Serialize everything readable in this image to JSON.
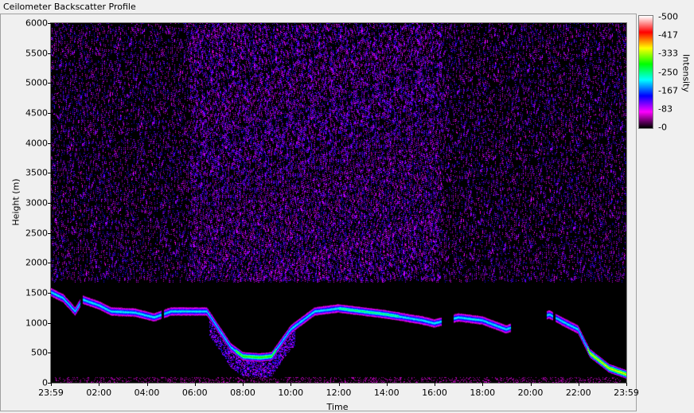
{
  "window": {
    "title": "Ceilometer Backscatter Profile"
  },
  "chart_data": {
    "type": "heatmap",
    "title": "",
    "xlabel": "Time",
    "ylabel": "Height (m)",
    "x_ticks": [
      "23:59",
      "02:00",
      "04:00",
      "06:00",
      "08:00",
      "10:00",
      "12:00",
      "14:00",
      "16:00",
      "18:00",
      "20:00",
      "22:00",
      "23:59"
    ],
    "x_range": [
      "23:59",
      "23:59"
    ],
    "y_ticks": [
      0,
      500,
      1000,
      1500,
      2000,
      2500,
      3000,
      3500,
      4000,
      4500,
      5000,
      5500,
      6000
    ],
    "ylim": [
      0,
      6000
    ],
    "colorbar": {
      "label": "Intensity",
      "ticks": [
        "-500",
        "-417",
        "-333",
        "-250",
        "-167",
        "-83",
        "-0"
      ],
      "range": [
        0,
        500
      ],
      "colors": [
        "#000000",
        "#ff00ff",
        "#0000ff",
        "#00ffff",
        "#00ff00",
        "#ffff00",
        "#ff0000",
        "#ffffff"
      ]
    },
    "cloud_layer_base_m": [
      {
        "t": 0.0,
        "h": 1520
      },
      {
        "t": 0.5,
        "h": 1420
      },
      {
        "t": 1.0,
        "h": 1200
      },
      {
        "t": 1.3,
        "h": 1400
      },
      {
        "t": 2.0,
        "h": 1300
      },
      {
        "t": 2.5,
        "h": 1200
      },
      {
        "t": 3.5,
        "h": 1180
      },
      {
        "t": 4.3,
        "h": 1100
      },
      {
        "t": 5.0,
        "h": 1200
      },
      {
        "t": 6.5,
        "h": 1200
      },
      {
        "t": 7.0,
        "h": 900
      },
      {
        "t": 7.5,
        "h": 600
      },
      {
        "t": 8.0,
        "h": 450
      },
      {
        "t": 8.7,
        "h": 430
      },
      {
        "t": 9.2,
        "h": 450
      },
      {
        "t": 10.0,
        "h": 900
      },
      {
        "t": 11.0,
        "h": 1200
      },
      {
        "t": 12.0,
        "h": 1250
      },
      {
        "t": 13.0,
        "h": 1200
      },
      {
        "t": 14.0,
        "h": 1150
      },
      {
        "t": 15.5,
        "h": 1050
      },
      {
        "t": 16.0,
        "h": 1000
      },
      {
        "t": 17.0,
        "h": 1100
      },
      {
        "t": 18.0,
        "h": 1050
      },
      {
        "t": 19.0,
        "h": 900
      },
      {
        "t": 20.8,
        "h": 1150
      },
      {
        "t": 21.5,
        "h": 1000
      },
      {
        "t": 22.0,
        "h": 900
      },
      {
        "t": 22.5,
        "h": 500
      },
      {
        "t": 23.3,
        "h": 250
      },
      {
        "t": 24.0,
        "h": 150
      }
    ]
  }
}
